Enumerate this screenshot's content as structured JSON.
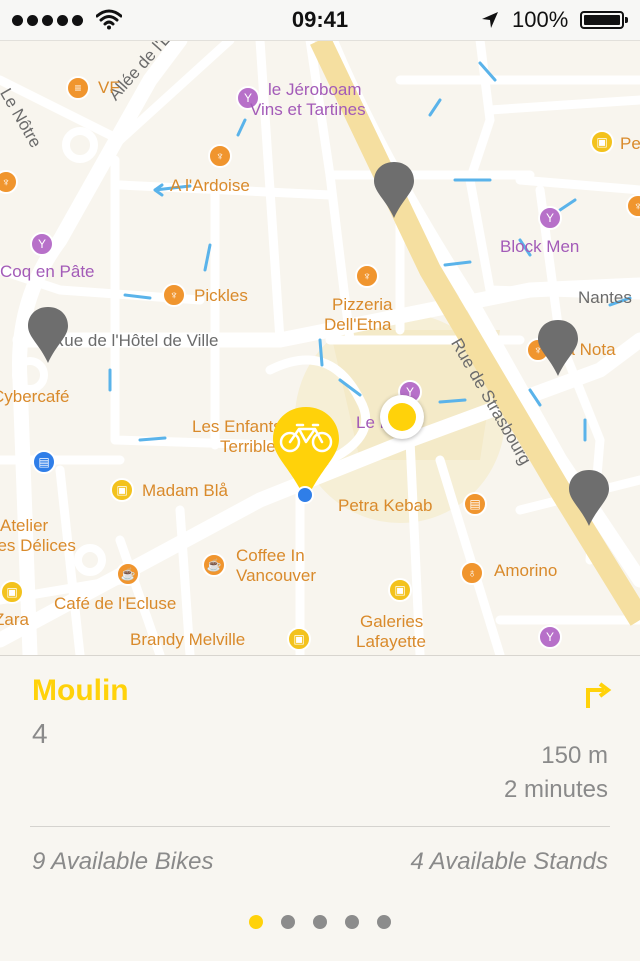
{
  "status_bar": {
    "time": "09:41",
    "battery": "100%"
  },
  "colors": {
    "accent": "#ffd20a",
    "pin_grey": "#6e6e6e",
    "poi_orange": "#f0952e",
    "poi_purple": "#b770c9",
    "poi_yellow": "#f3c21d"
  },
  "map": {
    "street_labels": [
      "Allée de l'Erdre",
      "Le Nôtre",
      "Rue de l'Hôtel de Ville",
      "Rue de Strasbourg",
      "Nantes"
    ],
    "places": {
      "vf": "VF",
      "jeroboam_1": "le Jéroboam",
      "jeroboam_2": "Vins et Tartines",
      "ardoise": "A l'Ardoise",
      "coq": "Coq en Pâte",
      "pickles": "Pickles",
      "pizzeria_1": "Pizzeria",
      "pizzeria_2": "Dell'Etna",
      "block_men": "Block Men",
      "pe": "Pe",
      "la_nota": "La Nota",
      "cybercafe": "Cybercafé",
      "enfants_1": "Les Enfants",
      "enfants_2": "Terribles",
      "le_howe": "Le Howe",
      "madam_bla": "Madam Blå",
      "petra_kebab": "Petra Kebab",
      "atelier_1": "Atelier",
      "atelier_2": "des Délices",
      "coffee_1": "Coffee In",
      "coffee_2": "Vancouver",
      "amorino": "Amorino",
      "cafe_ecluse": "Café de l'Ecluse",
      "zara": "Zara",
      "brandy": "Brandy Melville",
      "galeries_1": "Galeries",
      "galeries_2": "Lafayette"
    },
    "selected_pin_icon": "bicycle-icon"
  },
  "station": {
    "name": "Moulin",
    "number": "4",
    "distance": "150 m",
    "duration": "2 minutes",
    "bikes": "9 Available Bikes",
    "stands": "4 Available Stands"
  },
  "pager": {
    "total": 5,
    "active_index": 0
  }
}
